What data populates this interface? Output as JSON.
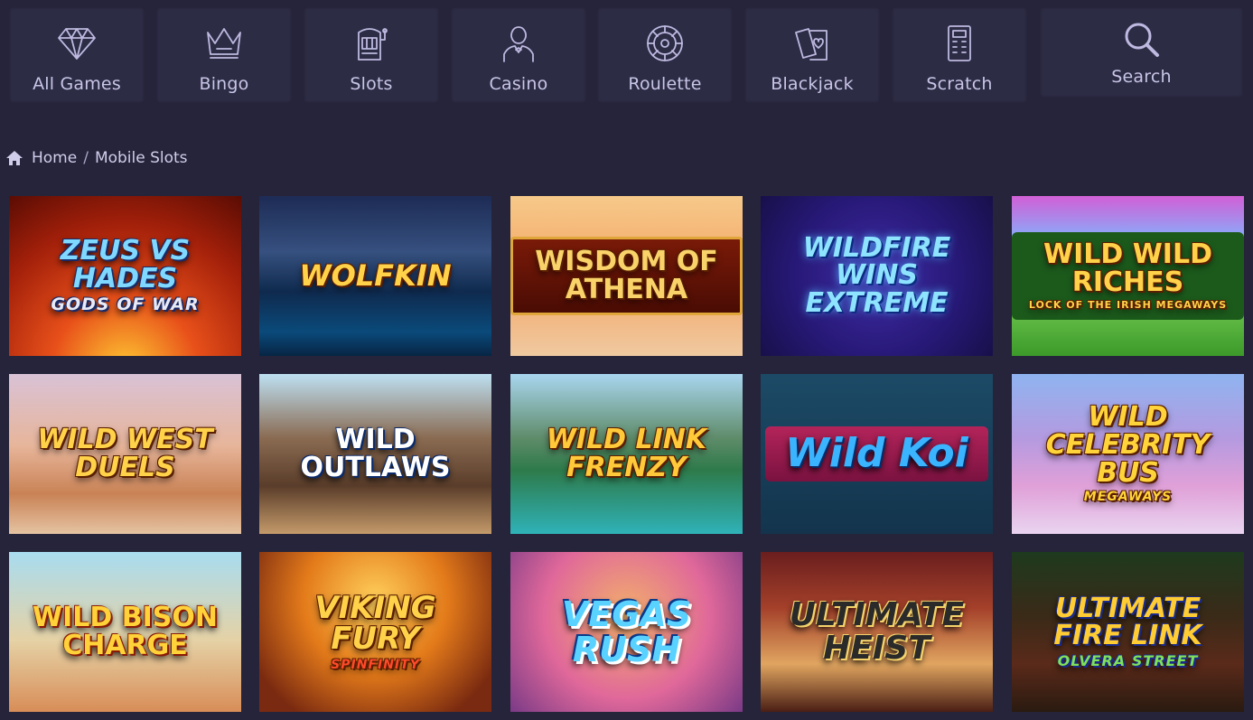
{
  "nav": [
    {
      "label": "All Games",
      "icon": "diamond-icon"
    },
    {
      "label": "Bingo",
      "icon": "crown-icon"
    },
    {
      "label": "Slots",
      "icon": "slot-machine-icon"
    },
    {
      "label": "Casino",
      "icon": "dealer-icon"
    },
    {
      "label": "Roulette",
      "icon": "roulette-icon"
    },
    {
      "label": "Blackjack",
      "icon": "cards-icon"
    },
    {
      "label": "Scratch",
      "icon": "scratch-card-icon"
    },
    {
      "label": "Search",
      "icon": "search-icon"
    }
  ],
  "breadcrumb": {
    "home": "Home",
    "separator": "/",
    "current": "Mobile Slots"
  },
  "games": [
    {
      "title": "ZEUS VS HADES",
      "subtitle": "GODS OF WAR"
    },
    {
      "title": "WOLFKIN",
      "subtitle": ""
    },
    {
      "title": "WISDOM OF ATHENA",
      "subtitle": ""
    },
    {
      "title": "WILDFIRE WINS EXTREME",
      "subtitle": ""
    },
    {
      "title": "WILD WILD RICHES",
      "subtitle": "LOCK OF THE IRISH MEGAWAYS"
    },
    {
      "title": "WILD WEST DUELS",
      "subtitle": ""
    },
    {
      "title": "WILD OUTLAWS",
      "subtitle": ""
    },
    {
      "title": "WILD LINK Frenzy",
      "subtitle": ""
    },
    {
      "title": "Wild Koi",
      "subtitle": ""
    },
    {
      "title": "WILD CELEBRITY BUS",
      "subtitle": "MEGAWAYS"
    },
    {
      "title": "WILD BISON CHARGE",
      "subtitle": ""
    },
    {
      "title": "VIKING FURY",
      "subtitle": "SPINFINITY"
    },
    {
      "title": "VEGAS RUSH",
      "subtitle": ""
    },
    {
      "title": "ULTIMATE HEIST",
      "subtitle": ""
    },
    {
      "title": "ULTIMATE FIRE LINK",
      "subtitle": "OLVERA STREET"
    }
  ]
}
